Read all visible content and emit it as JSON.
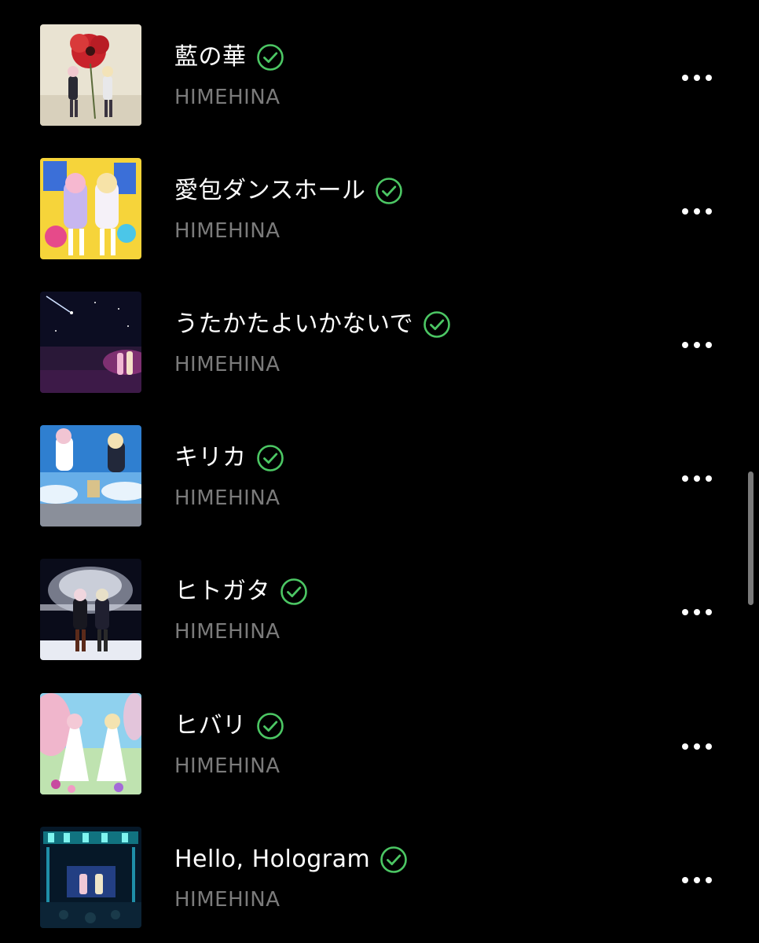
{
  "tracks": [
    {
      "title": "藍の華",
      "artist": "HIMEHINA",
      "downloaded": true,
      "art": "red-flower-two-girls-art"
    },
    {
      "title": "愛包ダンスホール",
      "artist": "HIMEHINA",
      "downloaded": true,
      "art": "yellow-pop-dance-art"
    },
    {
      "title": "うたかたよいかないで",
      "artist": "HIMEHINA",
      "downloaded": true,
      "art": "night-sky-shooting-star-art"
    },
    {
      "title": "キリカ",
      "artist": "HIMEHINA",
      "downloaded": true,
      "art": "blue-sky-clouds-art"
    },
    {
      "title": "ヒトガタ",
      "artist": "HIMEHINA",
      "downloaded": true,
      "art": "white-tree-night-art"
    },
    {
      "title": "ヒバリ",
      "artist": "HIMEHINA",
      "downloaded": true,
      "art": "cherry-blossom-dresses-art"
    },
    {
      "title": "Hello, Hologram",
      "artist": "HIMEHINA",
      "downloaded": true,
      "art": "neon-stage-concert-art"
    }
  ],
  "colors": {
    "background": "#000000",
    "title": "#ffffff",
    "artist": "#7b7b7b",
    "downloaded_check": "#4cc764"
  },
  "icons": {
    "downloaded": "check-circle-icon",
    "more": "more-horizontal-icon"
  }
}
